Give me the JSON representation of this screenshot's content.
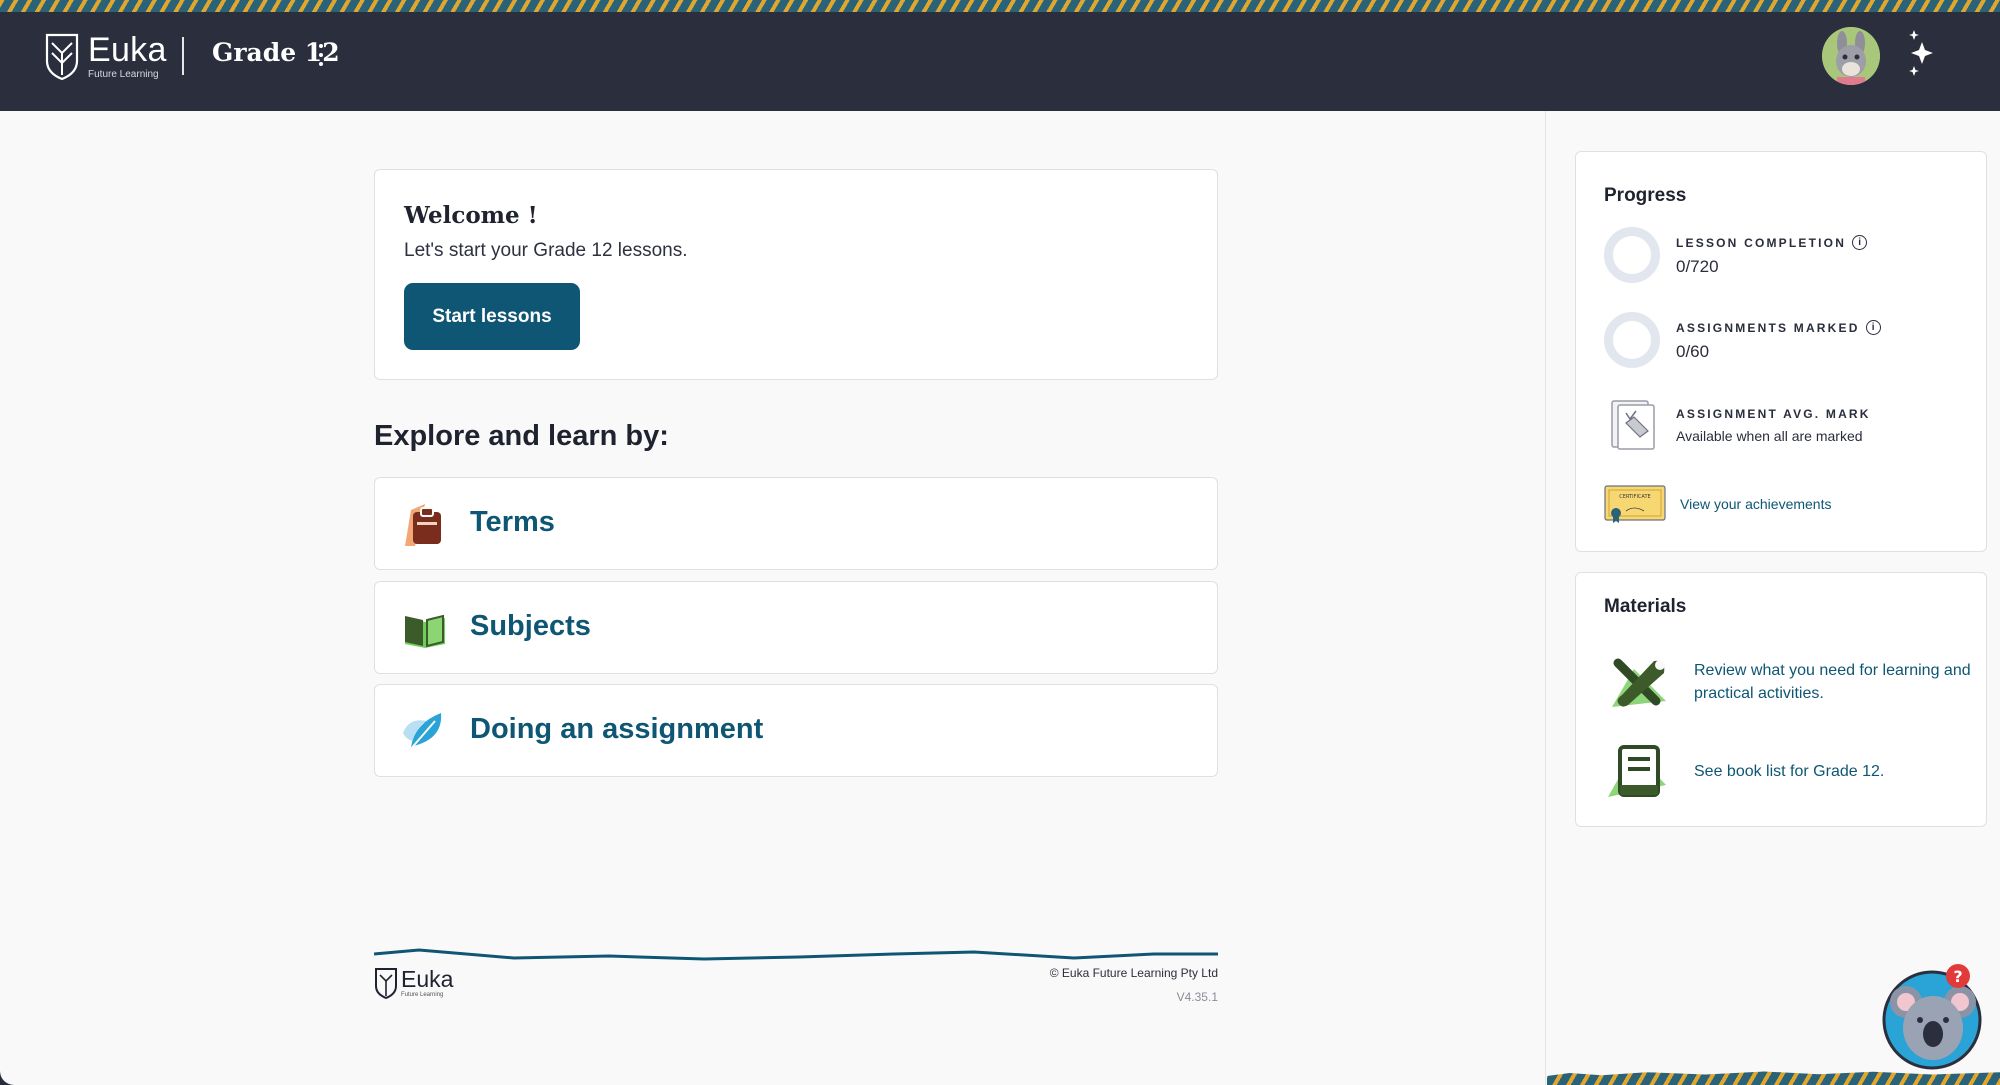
{
  "header": {
    "brand_name": "Euka",
    "brand_sub": "Future Learning",
    "grade_title": "Grade 12",
    "stripe_colors": [
      "#e0a62d",
      "#2a6278"
    ],
    "background": "#2b2e3d"
  },
  "welcome": {
    "title": "Welcome !",
    "subtitle": "Let's start your Grade 12 lessons.",
    "button_label": "Start lessons"
  },
  "explore": {
    "heading": "Explore and learn by:",
    "items": [
      {
        "label": "Terms",
        "icon": "clipboard-icon"
      },
      {
        "label": "Subjects",
        "icon": "open-book-icon"
      },
      {
        "label": "Doing an assignment",
        "icon": "feather-icon"
      }
    ]
  },
  "progress": {
    "title": "Progress",
    "lesson_completion": {
      "label": "LESSON COMPLETION",
      "value": "0/720",
      "completed": 0,
      "total": 720
    },
    "assignments_marked": {
      "label": "ASSIGNMENTS MARKED",
      "value": "0/60",
      "completed": 0,
      "total": 60
    },
    "avg_mark": {
      "label": "ASSIGNMENT AVG. MARK",
      "value": "Available when all are marked"
    },
    "achievements_link": "View your achievements",
    "certificate_text": "CERTIFICATE"
  },
  "materials": {
    "title": "Materials",
    "items": [
      {
        "label": "Review what you need for learning and practical activities.",
        "icon": "tools-icon"
      },
      {
        "label": "See book list for Grade 12.",
        "icon": "book-icon"
      }
    ]
  },
  "footer": {
    "brand_name": "Euka",
    "brand_sub": "Future Learning",
    "copyright": "© Euka Future Learning Pty Ltd",
    "version": "V4.35.1"
  },
  "colors": {
    "accent": "#0e5674",
    "text": "#1f2330",
    "page_bg": "#f9f9f9"
  }
}
